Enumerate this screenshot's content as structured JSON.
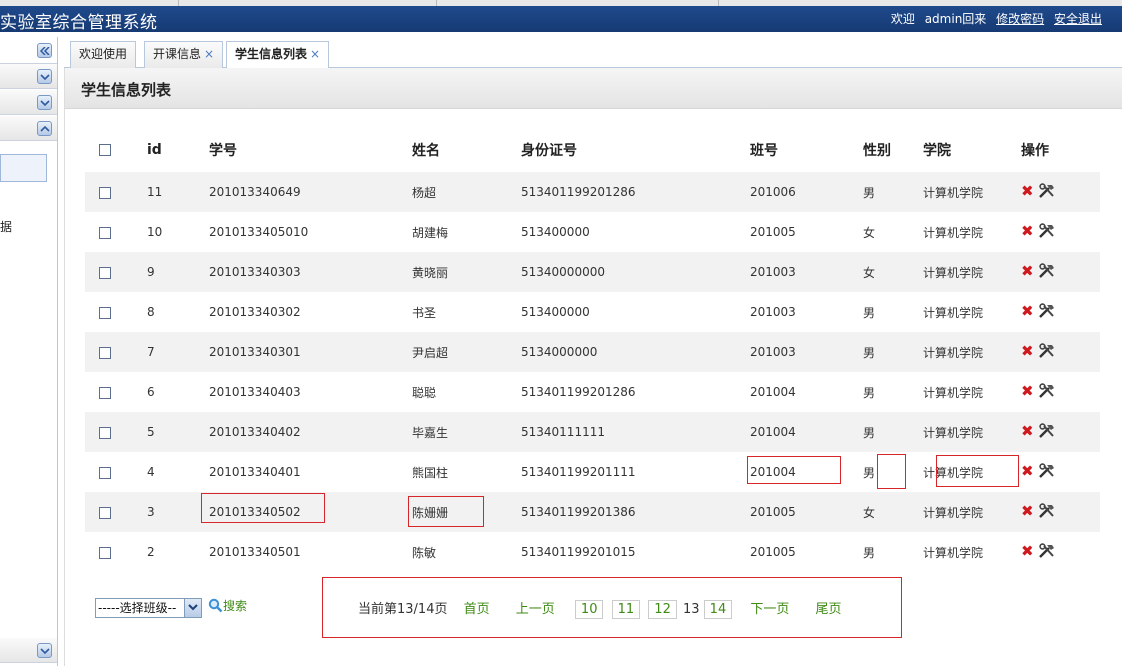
{
  "app": {
    "title": "实验室综合管理系统",
    "welcome": "欢迎",
    "user": "admin回来",
    "change_password": "修改密码",
    "logout": "安全退出"
  },
  "sidebar": {
    "collapse_icon": "double-chevron-left-icon",
    "text": "据"
  },
  "tabs": [
    {
      "label": "欢迎使用",
      "closable": false
    },
    {
      "label": "开课信息",
      "closable": true
    },
    {
      "label": "学生信息列表",
      "closable": true,
      "active": true
    }
  ],
  "tab_close": "×",
  "panel": {
    "title": "学生信息列表"
  },
  "table": {
    "headers": [
      "id",
      "学号",
      "姓名",
      "身份证号",
      "班号",
      "性别",
      "学院",
      "操作"
    ],
    "rows": [
      {
        "id": "11",
        "student_no": "201013340649",
        "name": "杨超",
        "id_card": "513401199201286",
        "class_no": "201006",
        "gender": "男",
        "college": "计算机学院"
      },
      {
        "id": "10",
        "student_no": "2010133405010",
        "name": "胡建梅",
        "id_card": "513400000",
        "class_no": "201005",
        "gender": "女",
        "college": "计算机学院"
      },
      {
        "id": "9",
        "student_no": "201013340303",
        "name": "黄晓丽",
        "id_card": "51340000000",
        "class_no": "201003",
        "gender": "女",
        "college": "计算机学院"
      },
      {
        "id": "8",
        "student_no": "201013340302",
        "name": "书圣",
        "id_card": "513400000",
        "class_no": "201003",
        "gender": "男",
        "college": "计算机学院"
      },
      {
        "id": "7",
        "student_no": "201013340301",
        "name": "尹启超",
        "id_card": "5134000000",
        "class_no": "201003",
        "gender": "男",
        "college": "计算机学院"
      },
      {
        "id": "6",
        "student_no": "201013340403",
        "name": "聪聪",
        "id_card": "513401199201286",
        "class_no": "201004",
        "gender": "男",
        "college": "计算机学院"
      },
      {
        "id": "5",
        "student_no": "201013340402",
        "name": "毕嘉生",
        "id_card": "51340111111",
        "class_no": "201004",
        "gender": "男",
        "college": "计算机学院"
      },
      {
        "id": "4",
        "student_no": "201013340401",
        "name": "熊国柱",
        "id_card": "513401199201111",
        "class_no": "201004",
        "gender": "男",
        "college": "计算机学院"
      },
      {
        "id": "3",
        "student_no": "201013340502",
        "name": "陈姗姗",
        "id_card": "513401199201386",
        "class_no": "201005",
        "gender": "女",
        "college": "计算机学院"
      },
      {
        "id": "2",
        "student_no": "201013340501",
        "name": "陈敏",
        "id_card": "513401199201015",
        "class_no": "201005",
        "gender": "男",
        "college": "计算机学院"
      }
    ],
    "delete_glyph": "✖",
    "delete_icon": "delete-x-icon",
    "edit_icon": "edit-tools-icon"
  },
  "footer": {
    "class_select": "-----选择班级--",
    "search_label": "搜索",
    "search_icon": "magnifier-icon",
    "pager": {
      "current": "当前第13/14页",
      "first": "首页",
      "prev": "上一页",
      "pages": [
        "10",
        "11",
        "12"
      ],
      "current_page": "13",
      "after_pages": [
        "14"
      ],
      "next": "下一页",
      "last": "尾页"
    }
  },
  "colors": {
    "header_bg": "#1f4a8c",
    "link_green": "#3e8a14",
    "delete_red": "#d0191c",
    "highlight_red": "#d6262a"
  }
}
